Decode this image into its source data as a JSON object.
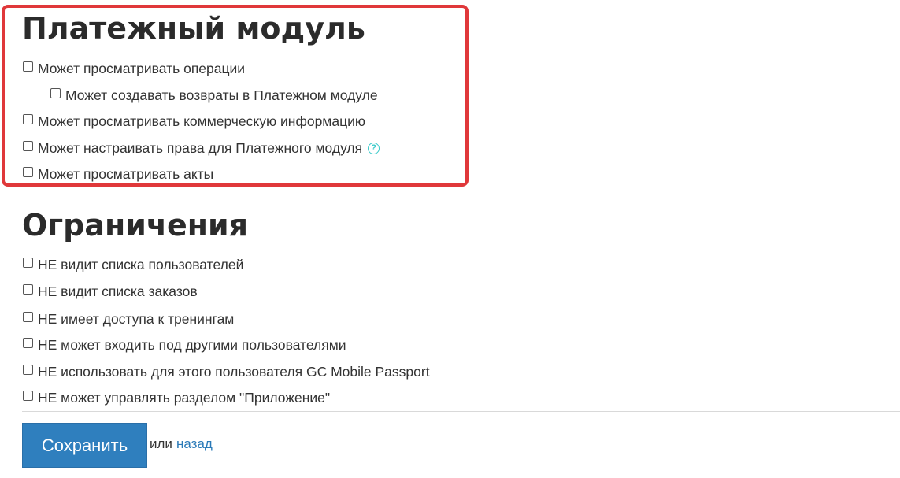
{
  "payment_module": {
    "title": "Платежный модуль",
    "items": [
      {
        "label": "Может просматривать операции"
      },
      {
        "label": "Может создавать возвраты в Платежном модуле"
      },
      {
        "label": "Может просматривать коммерческую информацию"
      },
      {
        "label": "Может настраивать права для Платежного модуля",
        "help_icon": "question-icon"
      },
      {
        "label": "Может просматривать акты"
      }
    ]
  },
  "restrictions": {
    "title": "Ограничения",
    "items": [
      {
        "label": "НЕ видит списка пользователей"
      },
      {
        "label": "НЕ видит списка заказов"
      },
      {
        "label": "НЕ имеет доступа к тренингам"
      },
      {
        "label": "НЕ может входить под другими пользователями"
      },
      {
        "label": "НЕ использовать для этого пользователя GC Mobile Passport"
      },
      {
        "label": "НЕ может управлять разделом \"Приложение\""
      }
    ]
  },
  "actions": {
    "save_label": "Сохранить",
    "or_text": "или",
    "back_label": "назад"
  },
  "colors": {
    "highlight_border": "#e0383a",
    "primary_button": "#2f7fbe",
    "link": "#2a7ab8",
    "help_icon": "#38c9c9"
  }
}
